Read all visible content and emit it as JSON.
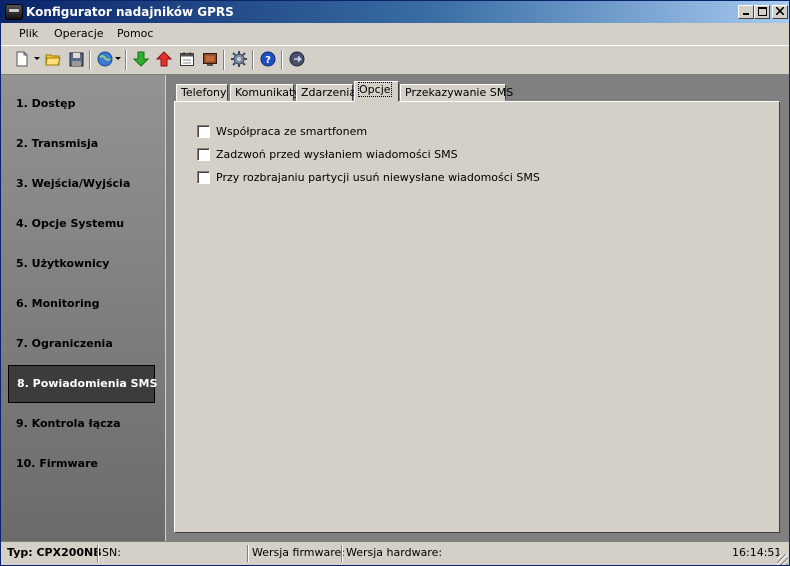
{
  "window": {
    "title": "Konfigurator nadajników GPRS"
  },
  "menu": [
    "Plik",
    "Operacje",
    "Pomoc"
  ],
  "toolbar": {
    "buttons": [
      {
        "icon": "new-file-icon"
      },
      {
        "icon": "open-folder-icon"
      },
      {
        "icon": "save-disk-icon"
      },
      {
        "icon": "globe-connect-icon"
      },
      {
        "icon": "download-arrow-icon"
      },
      {
        "icon": "upload-arrow-icon"
      },
      {
        "icon": "calendar-icon"
      },
      {
        "icon": "monitor-icon"
      },
      {
        "icon": "settings-gear-icon"
      },
      {
        "icon": "help-icon"
      },
      {
        "icon": "exit-icon"
      }
    ]
  },
  "sidebar": {
    "items": [
      {
        "label": "1. Dostęp"
      },
      {
        "label": "2. Transmisja"
      },
      {
        "label": "3. Wejścia/Wyjścia"
      },
      {
        "label": "4. Opcje Systemu"
      },
      {
        "label": "5. Użytkownicy"
      },
      {
        "label": "6. Monitoring"
      },
      {
        "label": "7. Ograniczenia"
      },
      {
        "label": "8. Powiadomienia SMS",
        "active": true
      },
      {
        "label": "9. Kontrola łącza"
      },
      {
        "label": "10. Firmware"
      }
    ]
  },
  "tabs": [
    {
      "label": "Telefony"
    },
    {
      "label": "Komunikaty"
    },
    {
      "label": "Zdarzenia"
    },
    {
      "label": "Opcje",
      "active": true
    },
    {
      "label": "Przekazywanie SMS"
    }
  ],
  "options": [
    {
      "label": "Współpraca ze smartfonem",
      "checked": false
    },
    {
      "label": "Zadzwoń przed wysłaniem wiadomości SMS",
      "checked": false
    },
    {
      "label": "Przy rozbrajaniu partycji usuń niewysłane wiadomości SMS",
      "checked": false
    }
  ],
  "status": {
    "type": "Typ: CPX200NB",
    "sn": "SN:",
    "firmware": "Wersja firmware:",
    "hardware": "Wersja hardware:",
    "time": "16:14:51"
  },
  "colors": {
    "titlebar": "#0a246a",
    "sidebar_active": "#3c3c3c",
    "face": "#d4d0c8"
  }
}
